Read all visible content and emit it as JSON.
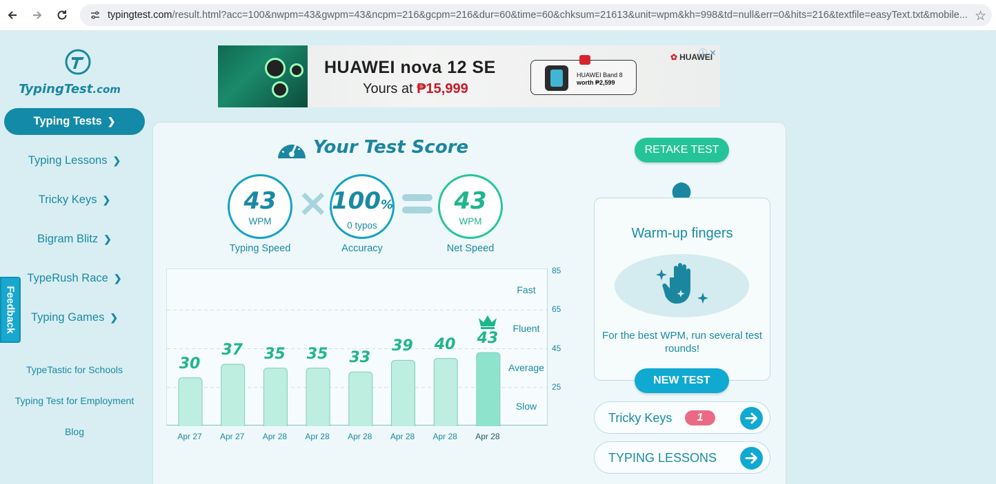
{
  "browser": {
    "url_host": "typingtest.com",
    "url_rest": "/result.html?acc=100&nwpm=43&gwpm=43&ncpm=216&gcpm=216&dur=60&time=60&chksum=21613&unit=wpm&kh=998&td=null&err=0&hits=216&textfile=easyText.txt&mobile..."
  },
  "logo": {
    "text": "TypingTest",
    "suffix": ".com"
  },
  "sidebar": {
    "items": [
      {
        "label": "Typing Tests",
        "active": true
      },
      {
        "label": "Typing Lessons"
      },
      {
        "label": "Tricky Keys"
      },
      {
        "label": "Bigram Blitz"
      },
      {
        "label": "TypeRush Race"
      },
      {
        "label": "Typing Games"
      }
    ],
    "links": [
      "TypeTastic for Schools",
      "Typing Test for Employment",
      "Blog"
    ],
    "feedback": "Feedback"
  },
  "ad": {
    "title": "HUAWEI nova 12 SE",
    "subtitle_prefix": "Yours at ",
    "price": "₱15,999",
    "box_line1": "HUAWEI Band 8",
    "box_line2": "worth ₱2,599",
    "brand": "HUAWEI"
  },
  "score": {
    "title": "Your Test Score",
    "typing_speed": {
      "value": "43",
      "unit": "WPM",
      "label": "Typing Speed"
    },
    "accuracy": {
      "value": "100",
      "pct": "%",
      "sub": "0 typos",
      "label": "Accuracy"
    },
    "net_speed": {
      "value": "43",
      "unit": "WPM",
      "label": "Net Speed"
    }
  },
  "chart_data": {
    "type": "bar",
    "categories": [
      "Apr 27",
      "Apr 27",
      "Apr 28",
      "Apr 28",
      "Apr 28",
      "Apr 28",
      "Apr 28",
      "Apr 28"
    ],
    "values": [
      30,
      37,
      35,
      35,
      33,
      39,
      40,
      43
    ],
    "ylim": [
      5,
      85
    ],
    "yticks": [
      85,
      65,
      45,
      25
    ],
    "bands": [
      "Fast",
      "Fluent",
      "Average",
      "Slow"
    ],
    "highlight_index": 7,
    "colors": {
      "bar": "#bdeee0",
      "bar_highlight": "#8ee3cc",
      "bar_border": "#7fcfb7",
      "value": "#1fb58d"
    }
  },
  "right": {
    "retake": "RETAKE TEST",
    "warm_title": "Warm-up fingers",
    "warm_desc": "For the best WPM, run several test rounds!",
    "new_test": "NEW TEST",
    "tricky_keys": "Tricky Keys",
    "tricky_count": "1",
    "lessons": "TYPING LESSONS"
  }
}
